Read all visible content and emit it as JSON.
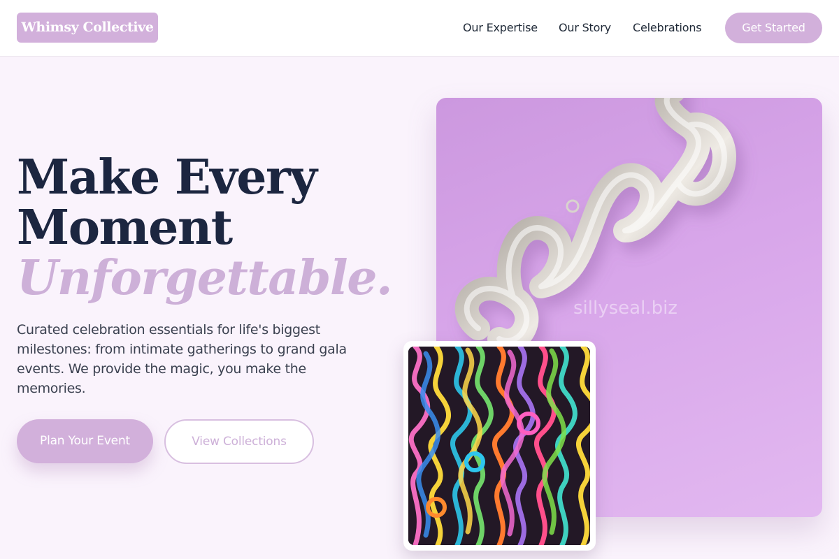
{
  "brand": {
    "name": "Whimsy Collective"
  },
  "nav": {
    "items": [
      {
        "label": "Our Expertise"
      },
      {
        "label": "Our Story"
      },
      {
        "label": "Celebrations"
      }
    ],
    "cta_label": "Get Started"
  },
  "hero": {
    "headline_line1": "Make Every",
    "headline_line2": "Moment",
    "headline_accent": "Unforgettable.",
    "subtext": "Curated celebration essentials for life's biggest milestones: from intimate gatherings to grand gala events. We provide the magic, you make the memories.",
    "primary_button": "Plan Your Event",
    "secondary_button": "View Collections"
  },
  "images": {
    "main_image_watermark": "sillyseal.biz",
    "main_image_icon": "cheers-balloon-image",
    "secondary_image_icon": "curling-ribbons-image"
  },
  "colors": {
    "accent": "#d2b0db",
    "headline": "#1c2640",
    "accent_text": "#cdb0d8",
    "background": "#faf3fc"
  }
}
